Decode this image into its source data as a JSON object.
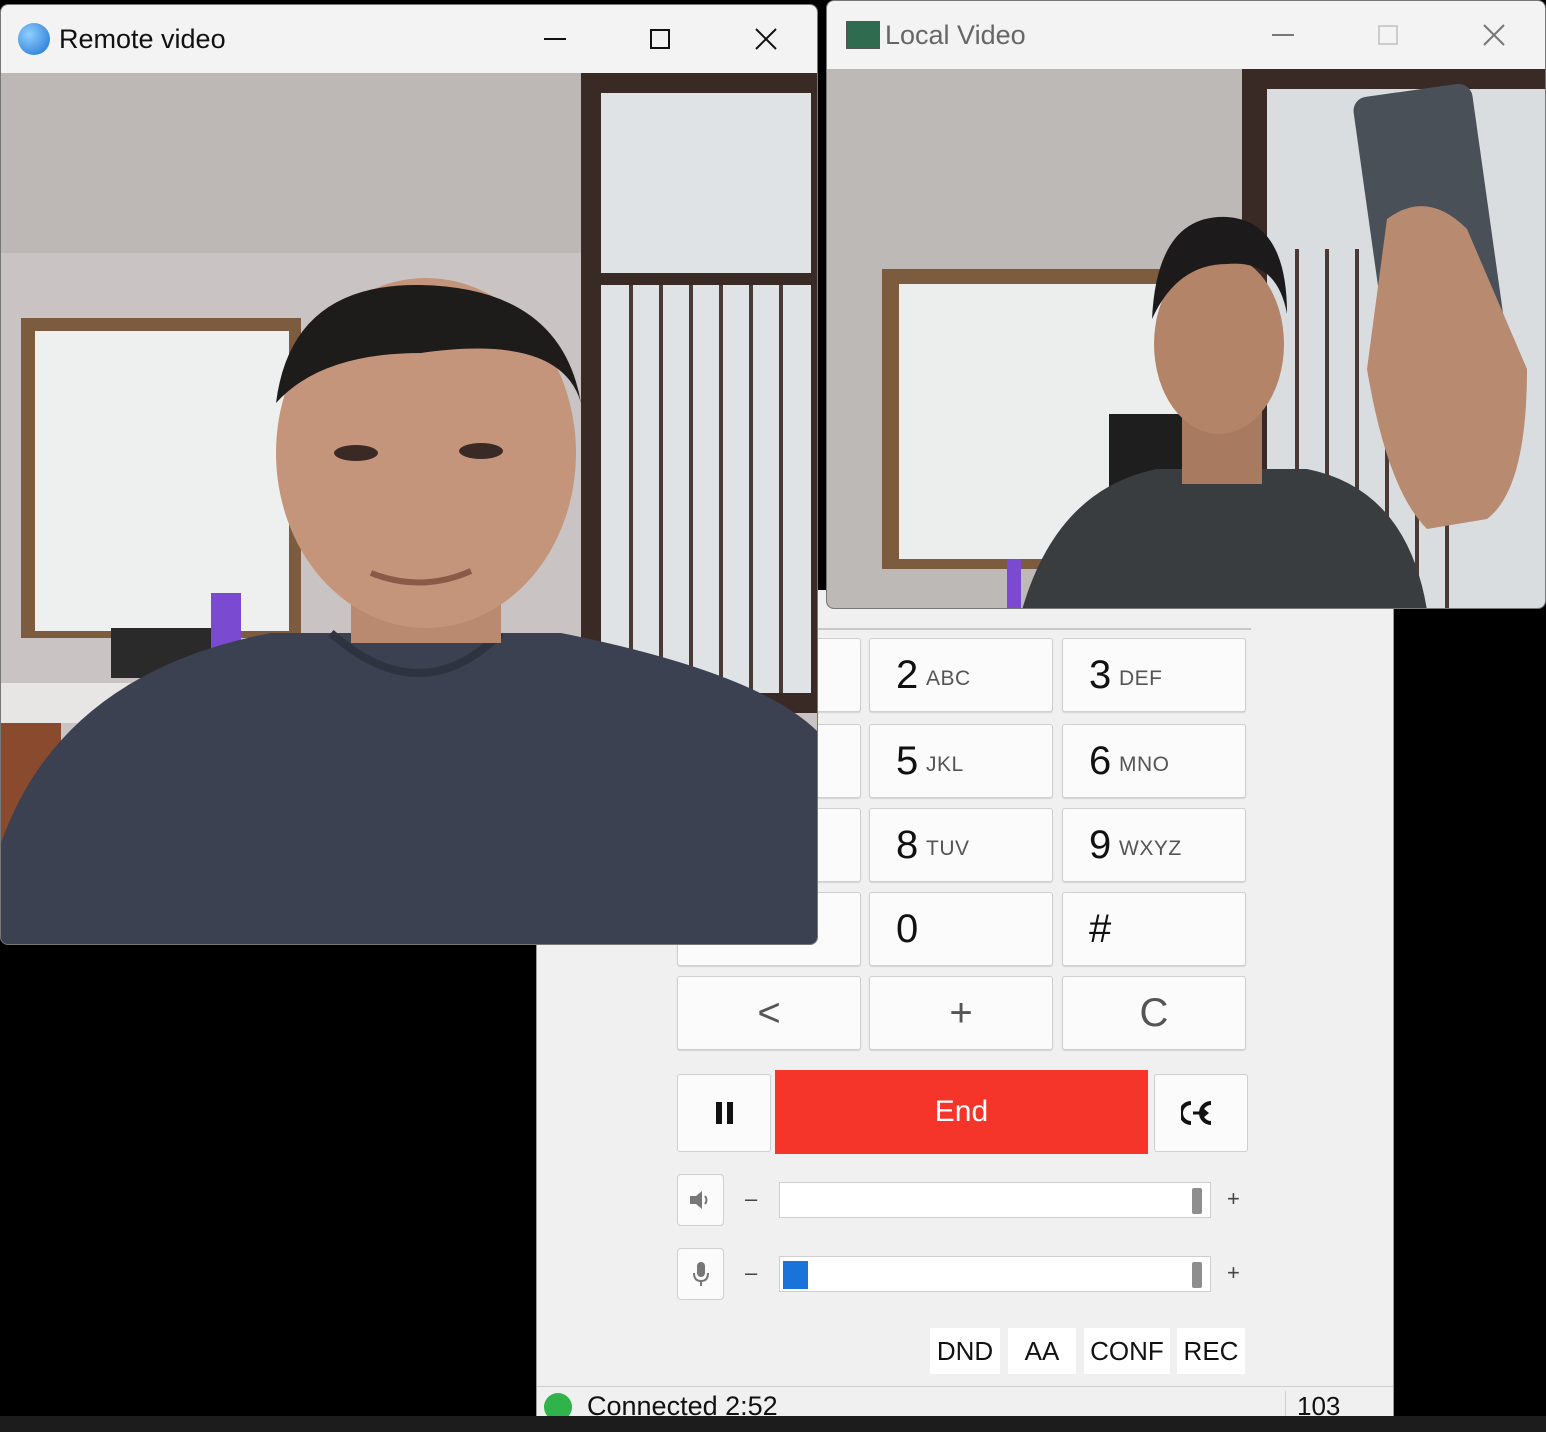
{
  "remote_window": {
    "title": "Remote video"
  },
  "local_window": {
    "title": "Local Video"
  },
  "dialer": {
    "keys": [
      {
        "digit": "2",
        "letters": "ABC"
      },
      {
        "digit": "3",
        "letters": "DEF"
      },
      {
        "digit": "5",
        "letters": "JKL"
      },
      {
        "digit": "6",
        "letters": "MNO"
      },
      {
        "digit": "8",
        "letters": "TUV"
      },
      {
        "digit": "9",
        "letters": "WXYZ"
      },
      {
        "digit": "0",
        "letters": ""
      },
      {
        "digit": "#",
        "letters": ""
      }
    ],
    "backspace_label": "<",
    "plus_label": "+",
    "clear_label": "C"
  },
  "call_controls": {
    "end_label": "End"
  },
  "audio": {
    "speaker": {
      "level": 0.0
    },
    "microphone": {
      "level": 0.06
    },
    "minus_label": "–",
    "plus_label": "+"
  },
  "features": {
    "dnd": "DND",
    "aa": "AA",
    "conf": "CONF",
    "rec": "REC"
  },
  "status": {
    "text": "Connected 2:52",
    "extension": "103"
  },
  "colors": {
    "end_button": "#f5352a",
    "mic_level": "#1a73d9",
    "connected": "#2fb34a"
  }
}
